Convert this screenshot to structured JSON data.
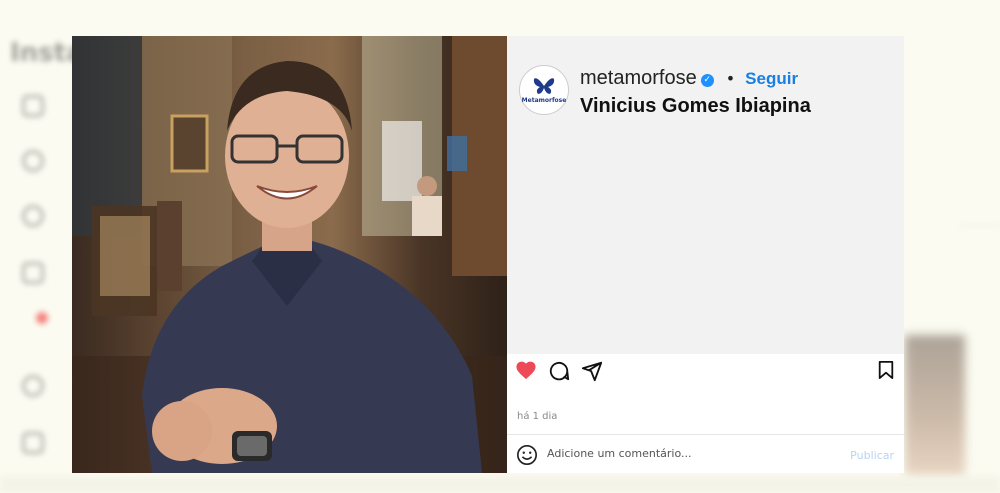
{
  "post": {
    "username": "metamorfose",
    "avatar_label": "Metamorfose",
    "separator": "•",
    "follow_label": "Seguir",
    "caption": "Vinicius Gomes Ibiapina",
    "timestamp": "há 1 dia",
    "liked": true
  },
  "comment": {
    "placeholder": "Adicione um comentário...",
    "publish_label": "Publicar"
  },
  "colors": {
    "accent": "#1a7fe0",
    "like": "#ed4956",
    "verified": "#1e90ff"
  },
  "icons": [
    "heart-icon",
    "comment-icon",
    "share-icon",
    "bookmark-icon",
    "emoji-icon",
    "verified-badge-icon",
    "butterfly-logo-icon"
  ]
}
